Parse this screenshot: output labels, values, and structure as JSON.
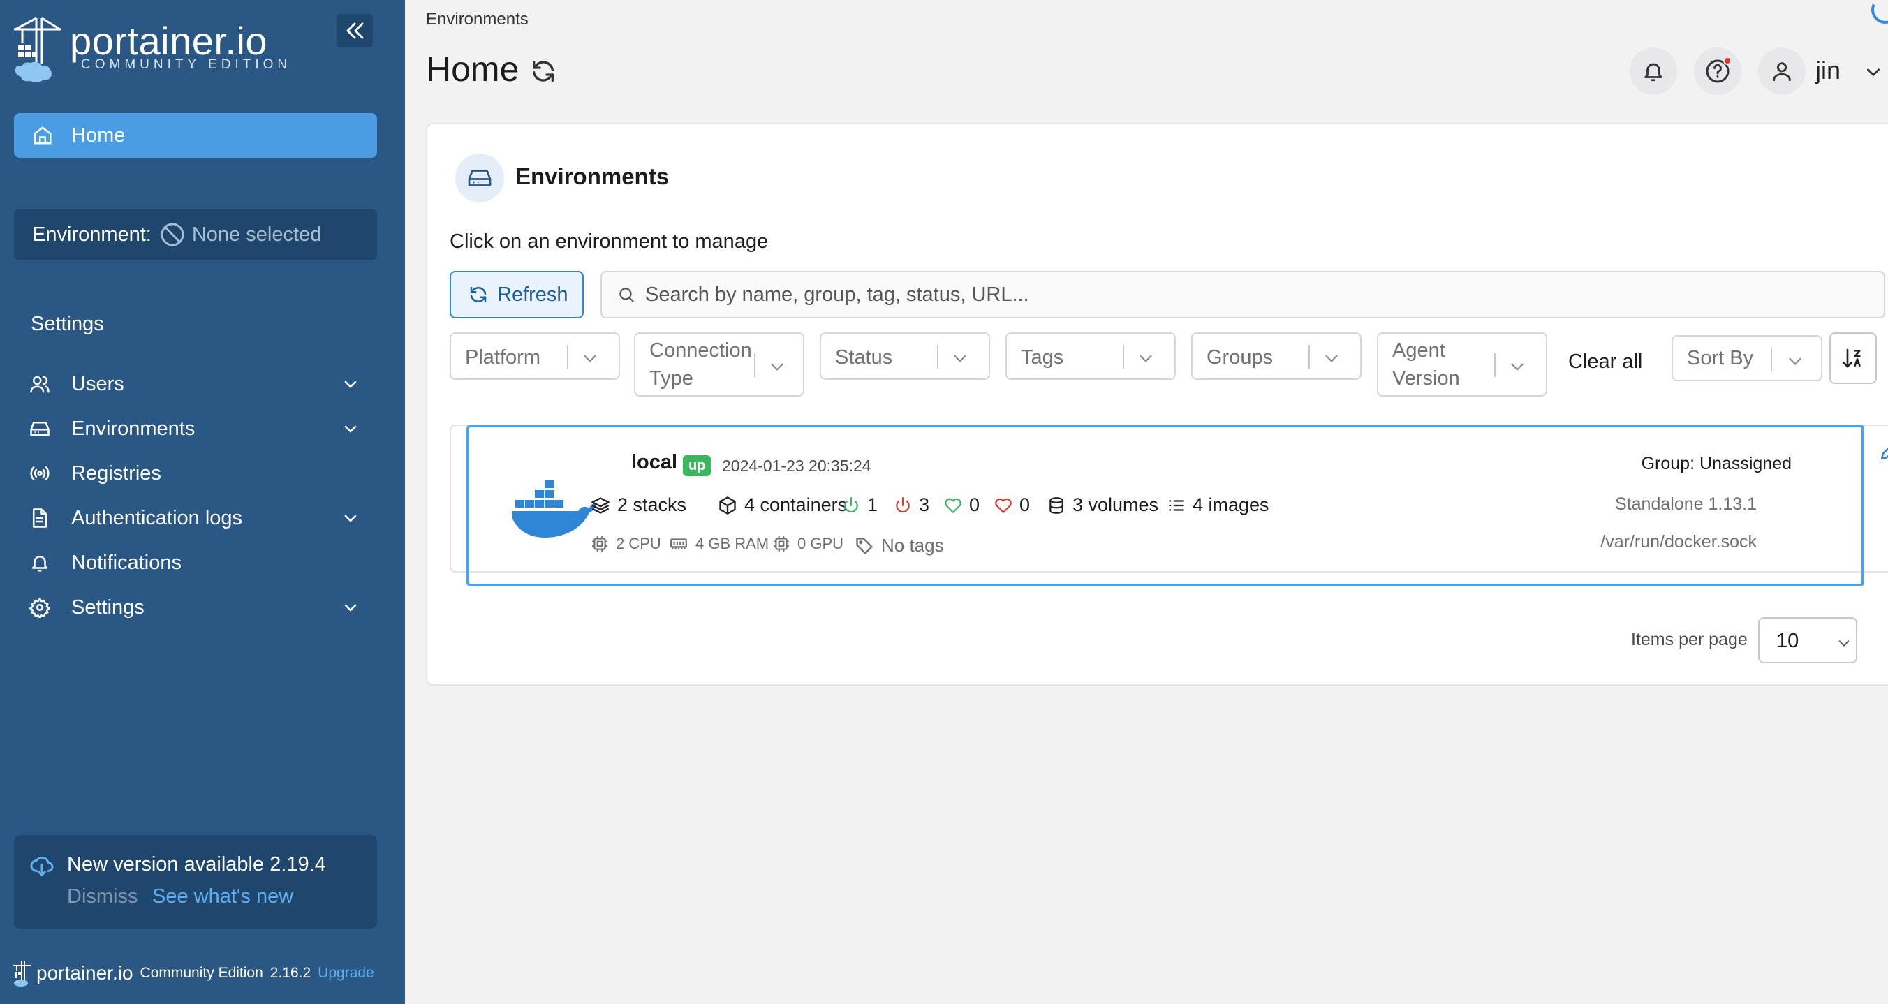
{
  "colors": {
    "sidebar_bg": "#2a5783",
    "sidebar_active": "#4a9de3",
    "accent_blue": "#2f86d6",
    "status_up": "#3db75d",
    "highlight": "#4aa3e6"
  },
  "brand": {
    "name": "portainer.io",
    "edition": "COMMUNITY EDITION",
    "logo_icon": "portainer-crane-icon"
  },
  "sidebar": {
    "collapse_icon": "double-chevron-left-icon",
    "home_label": "Home",
    "environment_label": "Environment:",
    "environment_value": "None selected",
    "settings_heading": "Settings",
    "items": [
      {
        "label": "Users",
        "icon": "users-icon",
        "expandable": true
      },
      {
        "label": "Environments",
        "icon": "hard-drive-icon",
        "expandable": true
      },
      {
        "label": "Registries",
        "icon": "radio-signal-icon",
        "expandable": false
      },
      {
        "label": "Authentication logs",
        "icon": "document-icon",
        "expandable": true
      },
      {
        "label": "Notifications",
        "icon": "bell-icon",
        "expandable": false
      },
      {
        "label": "Settings",
        "icon": "gear-icon",
        "expandable": true
      }
    ],
    "update": {
      "title": "New version available 2.19.4",
      "dismiss": "Dismiss",
      "whats_new": "See what's new"
    },
    "footer": {
      "brand": "portainer.io",
      "edition": "Community Edition",
      "version": "2.16.2",
      "upgrade": "Upgrade"
    }
  },
  "header": {
    "breadcrumb": "Environments",
    "title": "Home",
    "username": "jin"
  },
  "panel": {
    "title": "Environments",
    "hint": "Click on an environment to manage",
    "refresh_label": "Refresh",
    "search_placeholder": "Search by name, group, tag, status, URL...",
    "filters": {
      "platform": "Platform",
      "connection_type_1": "Connection",
      "connection_type_2": "Type",
      "status": "Status",
      "tags": "Tags",
      "groups": "Groups",
      "agent_version_1": "Agent",
      "agent_version_2": "Version"
    },
    "clear_all": "Clear all",
    "sort_by": "Sort By",
    "items_per_page_label": "Items per page",
    "items_per_page_value": "10"
  },
  "environment": {
    "name": "local",
    "status": "up",
    "timestamp": "2024-01-23 20:35:24",
    "stacks": "2 stacks",
    "containers": "4 containers",
    "running": "1",
    "stopped": "3",
    "healthy": "0",
    "unhealthy": "0",
    "volumes": "3 volumes",
    "images": "4 images",
    "cpu": "2 CPU",
    "ram": "4 GB RAM",
    "gpu": "0 GPU",
    "tags": "No tags",
    "group": "Group: Unassigned",
    "type": "Standalone 1.13.1",
    "url": "/var/run/docker.sock"
  }
}
